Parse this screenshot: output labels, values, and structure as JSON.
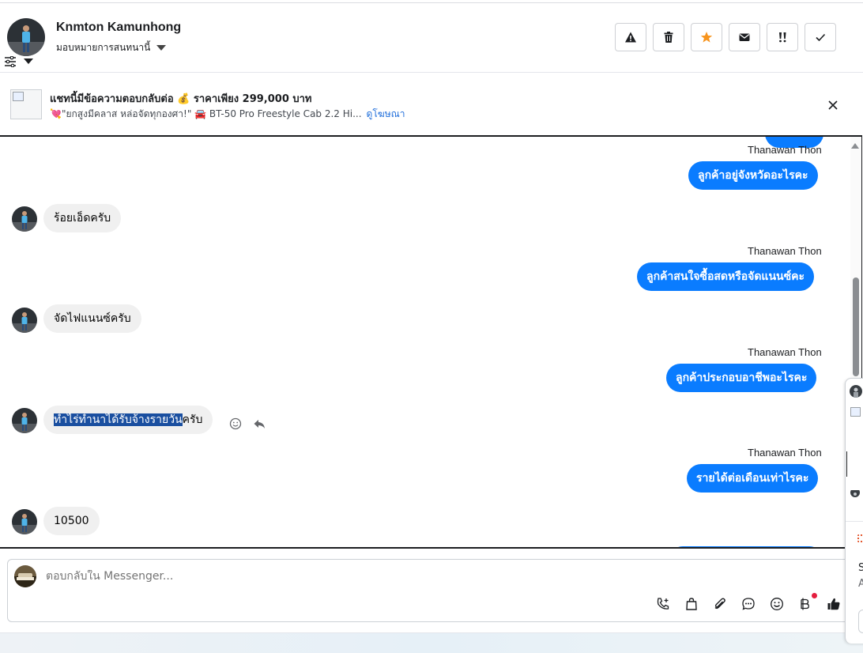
{
  "header": {
    "contact_name": "Knmton Kamunhong",
    "assign_label": "มอบหมายการสนทนานี้",
    "actions": [
      {
        "name": "spam-button",
        "icon": "warning-icon"
      },
      {
        "name": "delete-button",
        "icon": "trash-icon"
      },
      {
        "name": "star-button",
        "icon": "star-icon"
      },
      {
        "name": "mark-unread-button",
        "icon": "envelope-icon"
      },
      {
        "name": "follow-up-button",
        "icon": "double-exclamation-icon"
      },
      {
        "name": "mark-done-button",
        "icon": "checkmark-icon"
      }
    ],
    "star_color": "#f7941d"
  },
  "ad": {
    "title": "แชทนี้มีข้อความตอบกลับต่อ 💰 ราคาเพียง 299,000 บาท",
    "subtitle": "💘\"ยกสูงมีคลาส หล่อจัดทุกองศา!\" 🚘 BT-50 Pro Freestyle Cab 2.2 Hi...",
    "link": "ดูโฆษณา"
  },
  "messages": {
    "m1": {
      "sender": "Thanawan Thon",
      "text": "ลูกค้าอยู่จังหวัดอะไรคะ"
    },
    "m2": {
      "text": "ร้อยเอ็ดครับ"
    },
    "m3": {
      "sender": "Thanawan Thon",
      "text": "ลูกค้าสนใจซื้อสดหรือจัดแนนซ์คะ"
    },
    "m4": {
      "text": "จัดไฟแนนซ์ครับ"
    },
    "m5": {
      "sender": "Thanawan Thon",
      "text": "ลูกค้าประกอบอาชีพอะไรคะ"
    },
    "m6": {
      "text_selected": "ทำไร่ทำนาได้รับจ้างรายวัน",
      "text_rest": "ครับ"
    },
    "m7": {
      "sender": "Thanawan Thon",
      "text": "รายได้ต่อเดือนเท่าไรคะ"
    },
    "m8": {
      "text": "10500"
    }
  },
  "composer": {
    "placeholder": "ตอบกลับใน Messenger...",
    "tools": [
      "call-add-icon",
      "shopping-bag-icon",
      "paperclip-icon",
      "chat-bubble-icon",
      "emoji-icon",
      "baht-icon",
      "thumbs-up-icon"
    ]
  },
  "colors": {
    "outgoing_bubble": "#0a7cff",
    "incoming_bubble": "#f0f0f0",
    "link": "#216fdb"
  },
  "side_panel": {
    "letter_1": "S",
    "letter_2": "A"
  }
}
